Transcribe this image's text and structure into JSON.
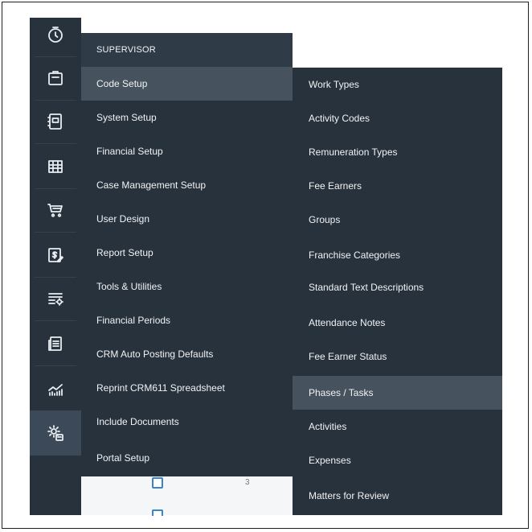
{
  "rail": {
    "icons": [
      {
        "name": "clock-icon"
      },
      {
        "name": "briefcase-icon"
      },
      {
        "name": "contact-card-icon"
      },
      {
        "name": "grid-icon"
      },
      {
        "name": "cart-icon"
      },
      {
        "name": "invoice-icon"
      },
      {
        "name": "settings-list-icon"
      },
      {
        "name": "documents-icon"
      },
      {
        "name": "chart-icon"
      },
      {
        "name": "admin-settings-icon"
      }
    ],
    "active_icon": "admin-settings-icon"
  },
  "menu1": {
    "header": "SUPERVISOR",
    "items": [
      "Code Setup",
      "System Setup",
      "Financial Setup",
      "Case Management Setup",
      "User Design",
      "Report Setup",
      "Tools & Utilities",
      "Financial Periods",
      "CRM Auto Posting Defaults",
      "Reprint CRM611 Spreadsheet",
      "Include Documents",
      "Portal Setup"
    ],
    "highlighted": "Code Setup"
  },
  "menu2": {
    "items": [
      "Work Types",
      "Activity Codes",
      "Remuneration Types",
      "Fee Earners",
      "Groups",
      "Franchise Categories",
      "Standard Text  Descriptions",
      "Attendance Notes",
      "Fee Earner Status",
      "Phases / Tasks",
      "Activities",
      "Expenses",
      "Matters for Review"
    ],
    "highlighted": "Phases / Tasks"
  },
  "background_list": {
    "count": "3"
  },
  "colors": {
    "menu_bg": "#27323d",
    "highlight_bg": "#46535f",
    "checkbox_border": "#3a86c8"
  }
}
